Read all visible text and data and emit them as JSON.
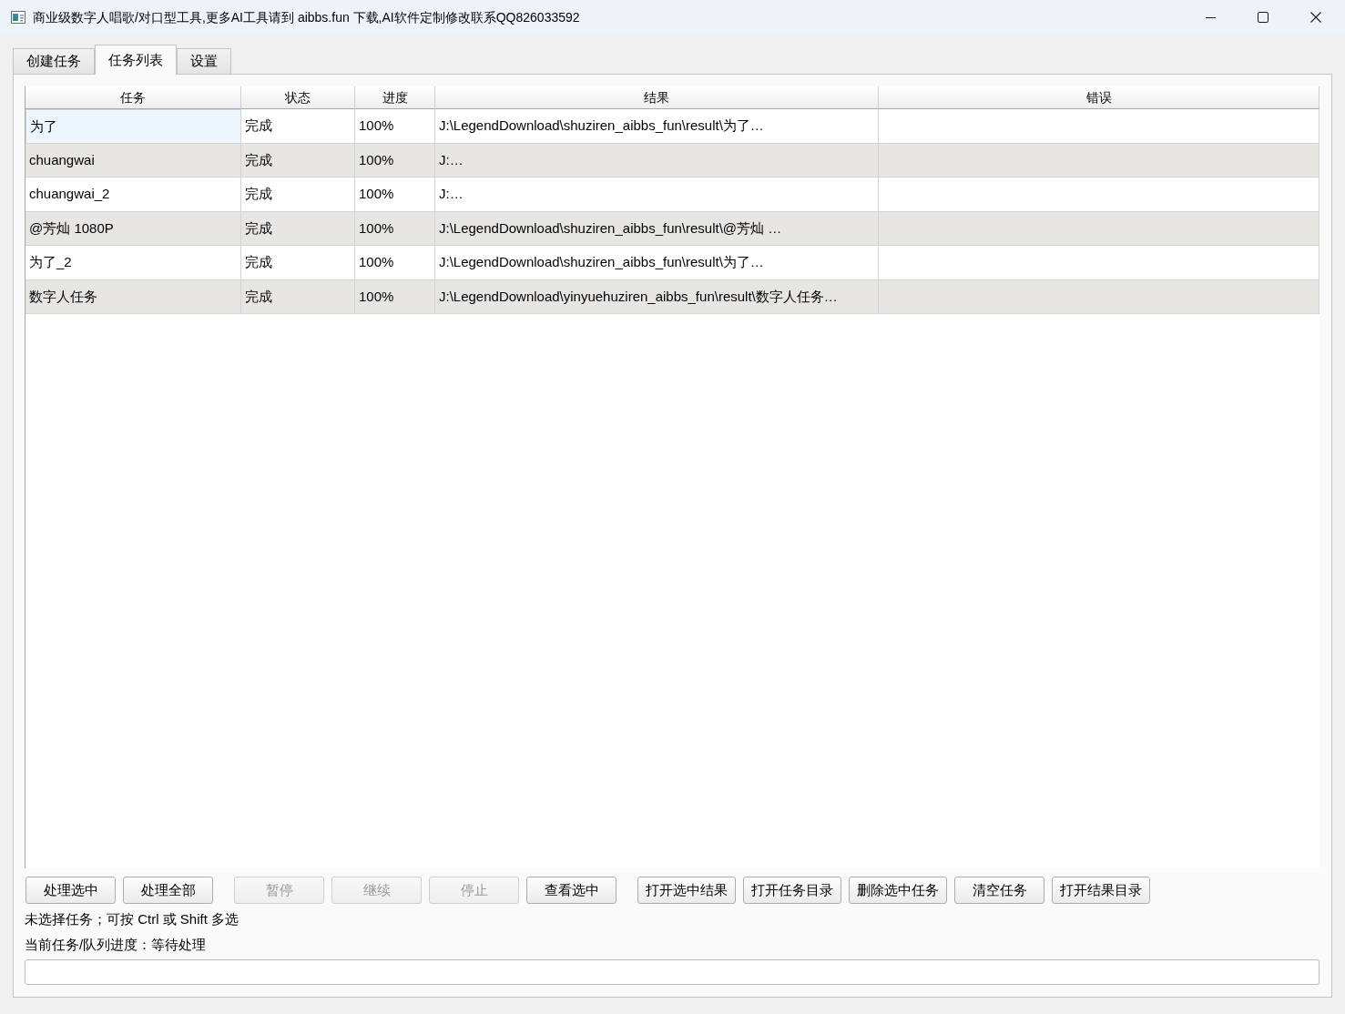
{
  "window": {
    "title": "商业级数字人唱歌/对口型工具,更多AI工具请到 aibbs.fun 下载,AI软件定制修改联系QQ826033592"
  },
  "tabs": [
    {
      "label": "创建任务",
      "selected": false
    },
    {
      "label": "任务列表",
      "selected": true
    },
    {
      "label": "设置",
      "selected": false
    }
  ],
  "task_table": {
    "columns": [
      "任务",
      "状态",
      "进度",
      "结果",
      "错误"
    ],
    "rows": [
      {
        "task": "为了",
        "status": "完成",
        "progress": "100%",
        "result": "J:\\LegendDownload\\shuziren_aibbs_fun\\result\\为了…",
        "current": true
      },
      {
        "task": "chuangwai",
        "status": "完成",
        "progress": "100%",
        "result": "J:…",
        "current": false
      },
      {
        "task": "chuangwai_2",
        "status": "完成",
        "progress": "100%",
        "result": "J:…",
        "current": false
      },
      {
        "task": "@芳灿 1080P",
        "status": "完成",
        "progress": "100%",
        "result": "J:\\LegendDownload\\shuziren_aibbs_fun\\result\\@芳灿 …",
        "current": false
      },
      {
        "task": "为了_2",
        "status": "完成",
        "progress": "100%",
        "result": "J:\\LegendDownload\\shuziren_aibbs_fun\\result\\为了…",
        "current": false
      },
      {
        "task": "数字人任务",
        "status": "完成",
        "progress": "100%",
        "result": "J:\\LegendDownload\\yinyuehuziren_aibbs_fun\\result\\数字人任务…",
        "current": false
      }
    ]
  },
  "button_groups": [
    [
      {
        "label": "处理选中",
        "disabled": false
      },
      {
        "label": "处理全部",
        "disabled": false
      }
    ],
    [
      {
        "label": "暂停",
        "disabled": true
      },
      {
        "label": "继续",
        "disabled": true
      },
      {
        "label": "停止",
        "disabled": true
      },
      {
        "label": "查看选中",
        "disabled": false
      }
    ],
    [
      {
        "label": "打开选中结果",
        "disabled": false
      },
      {
        "label": "打开任务目录",
        "disabled": false
      },
      {
        "label": "删除选中任务",
        "disabled": false
      },
      {
        "label": "清空任务",
        "disabled": false
      },
      {
        "label": "打开结果目录",
        "disabled": false
      }
    ]
  ],
  "selection_hint": "未选择任务；可按 Ctrl 或 Shift 多选",
  "progress_label": "当前任务/队列进度：等待处理",
  "progress_bar": {
    "level": 0
  }
}
